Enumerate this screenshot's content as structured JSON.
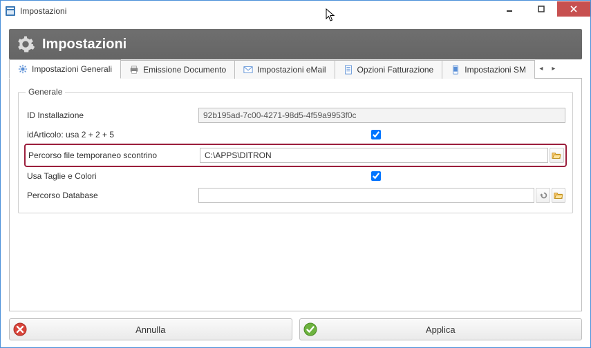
{
  "window": {
    "title": "Impostazioni"
  },
  "header": {
    "title": "Impostazioni"
  },
  "tabs": [
    {
      "label": "Impostazioni Generali",
      "active": true
    },
    {
      "label": "Emissione Documento",
      "active": false
    },
    {
      "label": "Impostazioni eMail",
      "active": false
    },
    {
      "label": "Opzioni Fatturazione",
      "active": false
    },
    {
      "label": "Impostazioni SM",
      "active": false
    }
  ],
  "group": {
    "legend": "Generale",
    "fields": {
      "id_install_label": "ID Installazione",
      "id_install_value": "92b195ad-7c00-4271-98d5-4f59a9953f0c",
      "id_articolo_label": "idArticolo: usa 2 + 2 + 5",
      "id_articolo_checked": true,
      "temp_path_label": "Percorso file temporaneo scontrino",
      "temp_path_value": "C:\\APPS\\DITRON",
      "taglie_label": "Usa Taglie e Colori",
      "taglie_checked": true,
      "db_path_label": "Percorso Database",
      "db_path_value": ""
    }
  },
  "buttons": {
    "cancel": "Annulla",
    "apply": "Applica"
  }
}
